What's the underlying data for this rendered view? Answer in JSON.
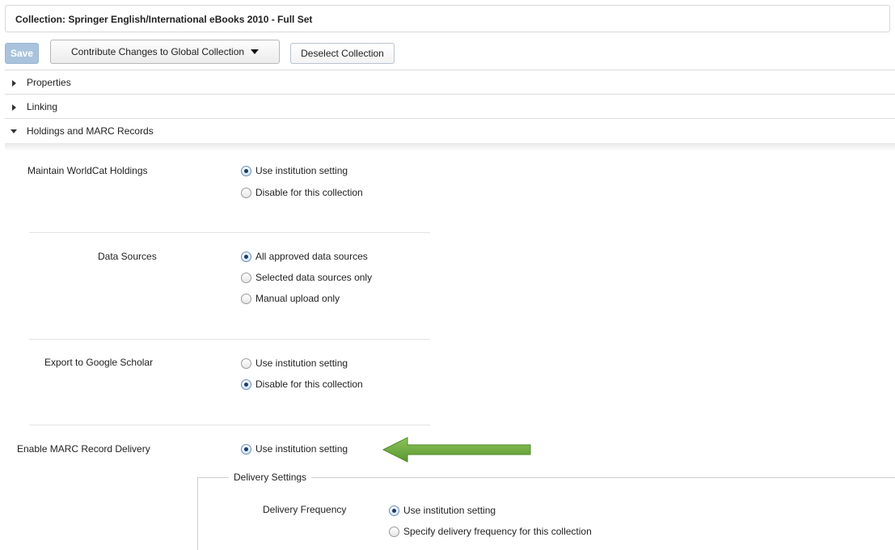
{
  "collection_title": "Collection: Springer English/International eBooks 2010 - Full Set",
  "toolbar": {
    "save_label": "Save",
    "contribute_label": "Contribute Changes to Global Collection",
    "deselect_label": "Deselect Collection"
  },
  "sections": [
    {
      "label": "Properties",
      "expanded": false
    },
    {
      "label": "Linking",
      "expanded": false
    },
    {
      "label": "Holdings and MARC Records",
      "expanded": true
    }
  ],
  "holdings": {
    "maintain_worldcat": {
      "label": "Maintain WorldCat Holdings",
      "options": [
        "Use institution setting",
        "Disable for this collection"
      ],
      "selected": "Use institution setting"
    },
    "data_sources": {
      "label": "Data Sources",
      "options": [
        "All approved data sources",
        "Selected data sources only",
        "Manual upload only"
      ],
      "selected": "All approved data sources"
    },
    "google_scholar": {
      "label": "Export to Google Scholar",
      "options": [
        "Use institution setting",
        "Disable for this collection"
      ],
      "selected": "Disable for this collection"
    },
    "marc_delivery": {
      "label": "Enable MARC Record Delivery",
      "options": [
        "Use institution setting"
      ],
      "selected": "Use institution setting"
    },
    "delivery_settings": {
      "legend": "Delivery Settings",
      "frequency": {
        "label": "Delivery Frequency",
        "options": [
          "Use institution setting",
          "Specify delivery frequency for this collection"
        ],
        "selected": "Use institution setting"
      }
    }
  },
  "colors": {
    "annotation_arrow": "#6aa33a",
    "save_button": "#a9c3dc",
    "radio_dot": "#1d3c63"
  },
  "icons": {
    "collapsed": "triangle-right-icon",
    "expanded": "triangle-down-icon",
    "dropdown": "caret-down-icon",
    "annotation": "green-arrow-left-icon"
  }
}
